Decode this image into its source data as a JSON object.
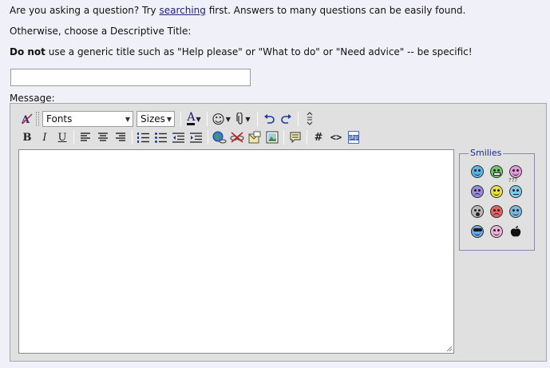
{
  "intro": {
    "line1_before": "Are you asking a question? Try ",
    "line1_link": "searching",
    "line1_after": " first. Answers to many questions can be easily found.",
    "line2": "Otherwise, choose a Descriptive Title:",
    "line3_bold": "Do not",
    "line3_rest": " use a generic title such as \"Help please\" or \"What to do\" or \"Need advice\" -- be specific!"
  },
  "title_input": {
    "value": "",
    "placeholder": ""
  },
  "message_label": "Message:",
  "toolbar": {
    "fonts_label": "Fonts",
    "sizes_label": "Sizes",
    "font_color_glyph": "A",
    "bold_glyph": "B",
    "italic_glyph": "I",
    "underline_glyph": "U",
    "hash_glyph": "#",
    "code_glyph": "<>",
    "php_glyph": "php"
  },
  "message_body": {
    "value": ""
  },
  "smilies": {
    "legend": "Smilies",
    "confused_marks": "???",
    "items": [
      {
        "icon": "cool-smile-icon",
        "color": "#5ab4e8"
      },
      {
        "icon": "grin-smile-icon",
        "color": "#6bc86b"
      },
      {
        "icon": "tongue-smile-icon",
        "color": "#e39ad8"
      },
      {
        "icon": "sad-smile-icon",
        "color": "#9a8ae0"
      },
      {
        "icon": "happy-smile-icon",
        "color": "#e8e040"
      },
      {
        "icon": "confused-smile-icon",
        "color": "#7ec8e8"
      },
      {
        "icon": "shocked-smile-icon",
        "color": "#b8b8b8"
      },
      {
        "icon": "mad-smile-icon",
        "color": "#e86060"
      },
      {
        "icon": "rolleyes-smile-icon",
        "color": "#7ab8e0"
      },
      {
        "icon": "sunglasses-smile-icon",
        "color": "#6aa8e8"
      },
      {
        "icon": "wink-smile-icon",
        "color": "#f0b0d8"
      },
      {
        "icon": "apple-icon",
        "color": "#111111"
      }
    ]
  }
}
